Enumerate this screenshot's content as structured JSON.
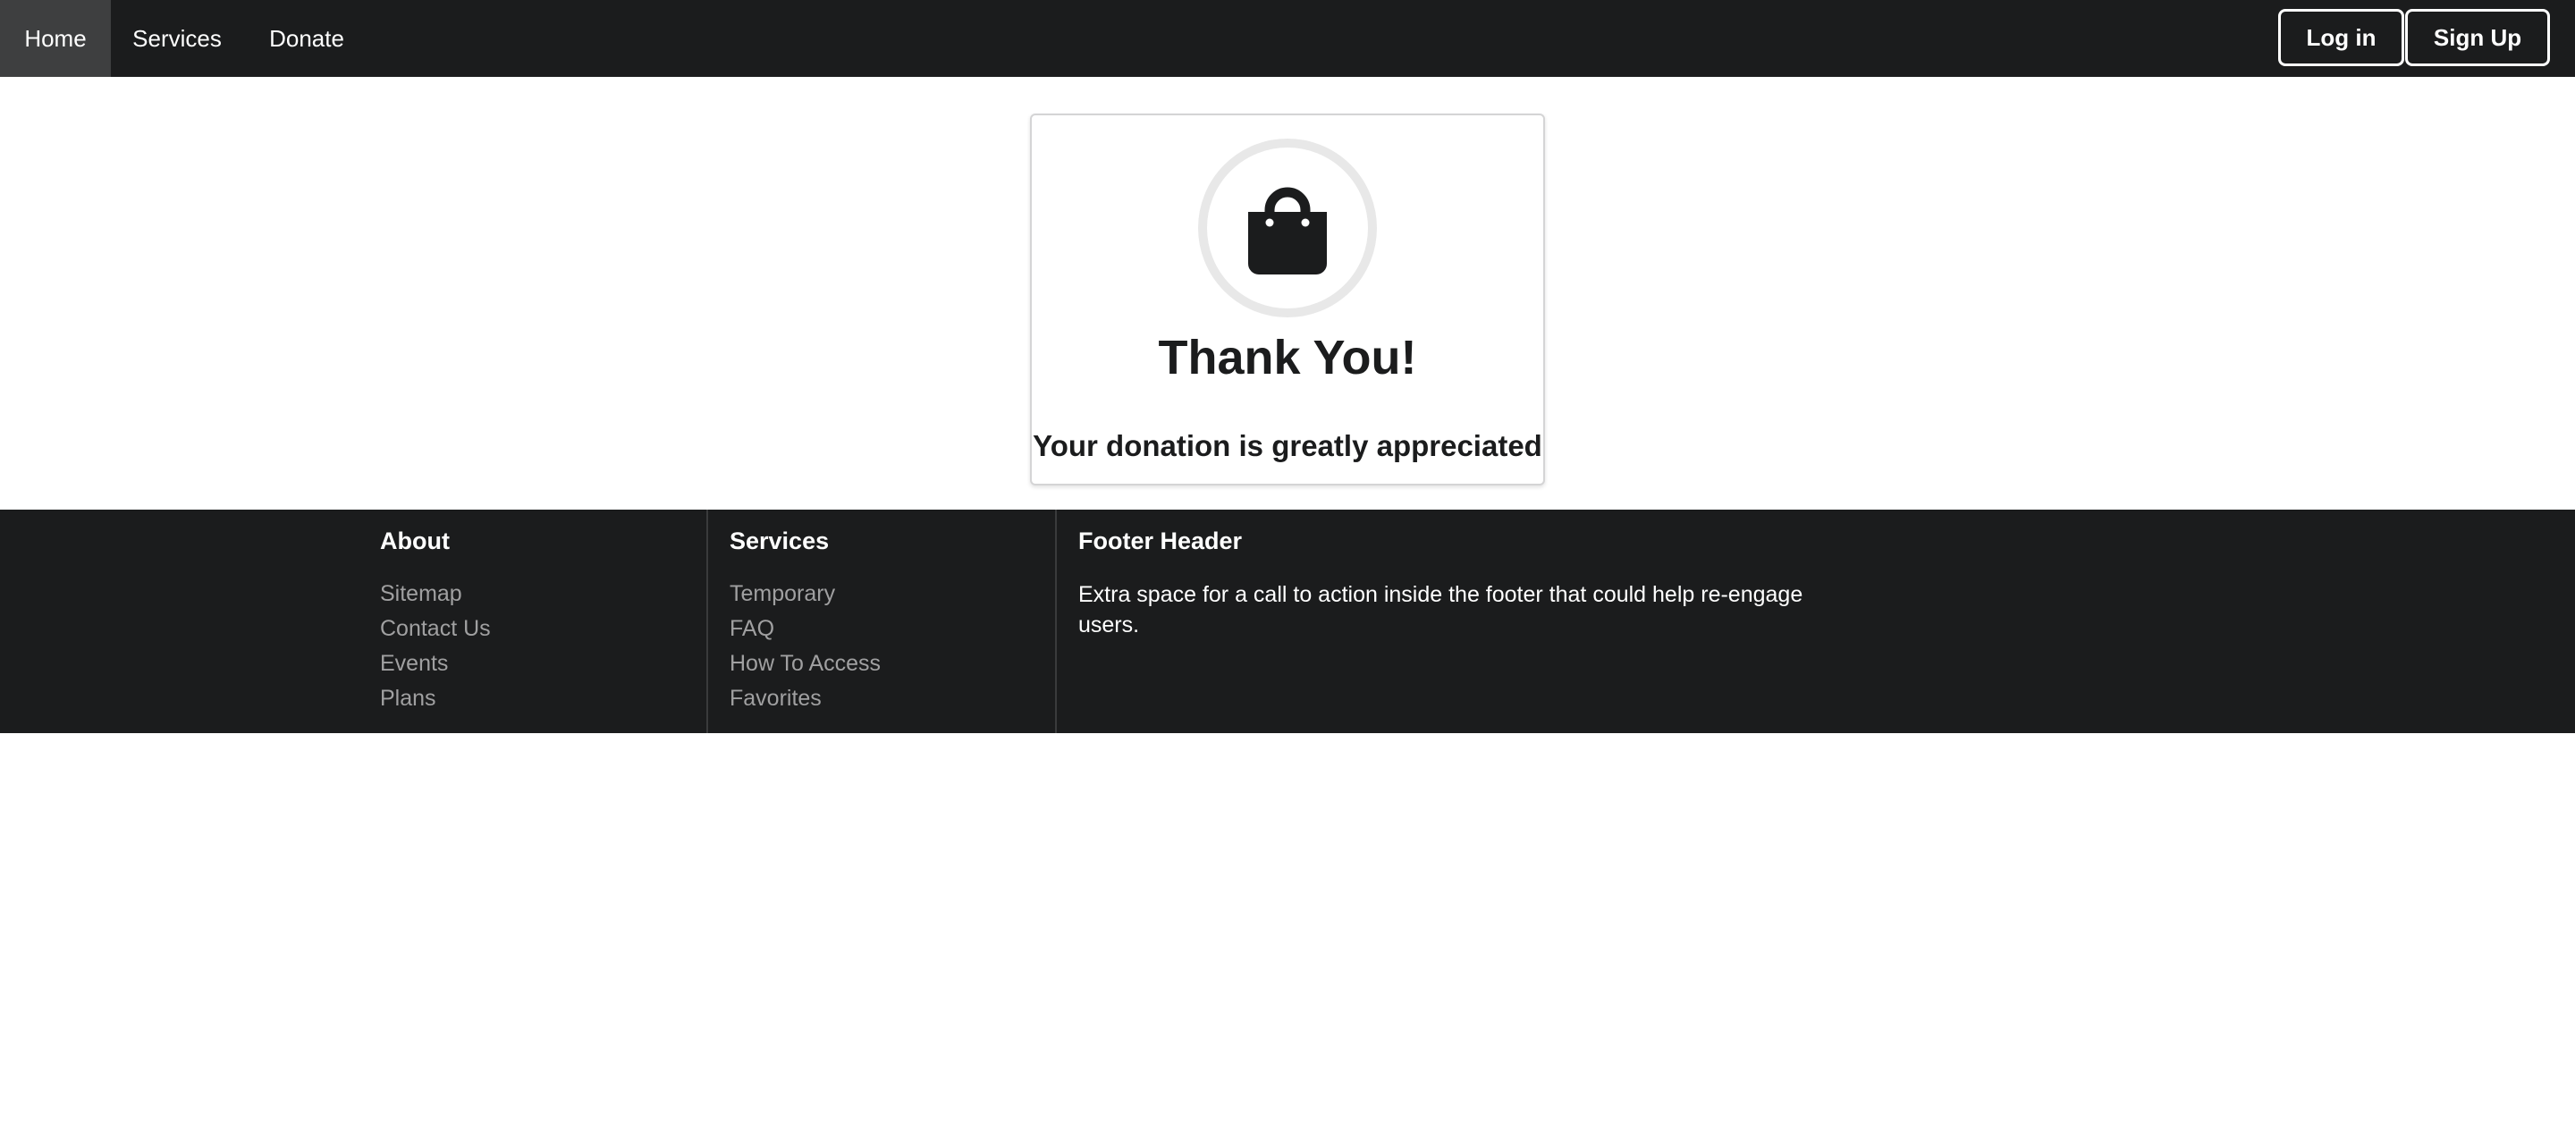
{
  "nav": {
    "items": [
      {
        "label": "Home"
      },
      {
        "label": "Services"
      },
      {
        "label": "Donate"
      }
    ],
    "login_label": "Log in",
    "signup_label": "Sign Up"
  },
  "card": {
    "icon": "shopping-bag-icon",
    "title": "Thank You!",
    "subtitle": "Your donation is greatly appreciated"
  },
  "footer": {
    "about": {
      "header": "About",
      "links": [
        "Sitemap",
        "Contact Us",
        "Events",
        "Plans"
      ]
    },
    "services": {
      "header": "Services",
      "links": [
        "Temporary",
        "FAQ",
        "How To Access",
        "Favorites"
      ]
    },
    "cta": {
      "header": "Footer Header",
      "text": "Extra space for a call to action inside the footer that could help re-engage users."
    }
  },
  "colors": {
    "nav_background": "#1b1c1d",
    "nav_active": "#3e3f40",
    "footer_background": "#1b1c1d",
    "footer_link": "#a0a0a1",
    "card_border": "#d4d4d5",
    "icon_circle": "#e8e8e8"
  }
}
